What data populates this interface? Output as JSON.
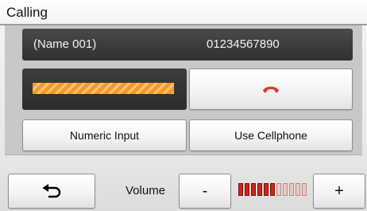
{
  "header": {
    "title": "Calling"
  },
  "call_info": {
    "contact_name": "(Name 001)",
    "phone_number": "01234567890"
  },
  "call_progress": {
    "icon": "calling-signal-bar",
    "color": "#f29a2e"
  },
  "actions": {
    "hangup_icon": "hangup-phone-icon",
    "hangup_color": "#e33b2e",
    "numeric_input_label": "Numeric Input",
    "use_cellphone_label": "Use Cellphone"
  },
  "footer": {
    "back_icon": "back-arrow-icon",
    "volume_label": "Volume",
    "minus_label": "-",
    "plus_label": "+",
    "volume_level": 6,
    "volume_max": 11,
    "volume_on_color": "#c8281b",
    "volume_off_color": "#e9c9c4"
  }
}
